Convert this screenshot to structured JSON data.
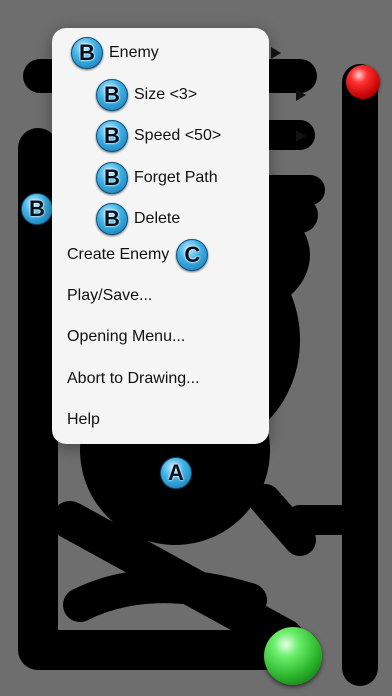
{
  "markers": {
    "a": "A",
    "b": "B",
    "c": "C"
  },
  "menu": {
    "items": [
      {
        "label": "Enemy",
        "marker": "B",
        "submenu": true
      },
      {
        "label": "Size <3>",
        "marker": "B",
        "submenu": true
      },
      {
        "label": "Speed <50>",
        "marker": "B",
        "submenu": true
      },
      {
        "label": "Forget Path",
        "marker": "B",
        "submenu": false
      },
      {
        "label": "Delete",
        "marker": "B",
        "submenu": false
      },
      {
        "label": "Create Enemy",
        "marker": "C",
        "submenu": false
      },
      {
        "label": "Play/Save...",
        "submenu": false
      },
      {
        "label": "Opening Menu...",
        "submenu": false
      },
      {
        "label": "Abort to Drawing...",
        "submenu": false
      },
      {
        "label": "Help",
        "submenu": false
      }
    ]
  },
  "colors": {
    "background": "#6e6e6e",
    "path": "#000000",
    "menu": "#f5f5f5",
    "marker": "#3fb2e6",
    "goal_ball": "#ff3030",
    "player_ball": "#2bb52b"
  }
}
